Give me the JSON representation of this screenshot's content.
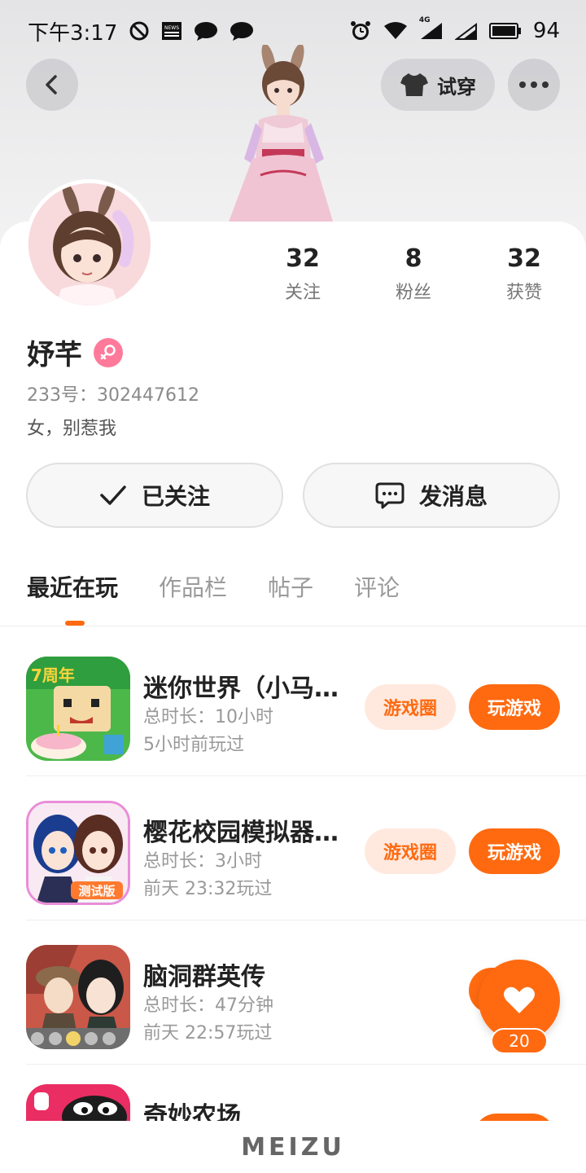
{
  "status_bar": {
    "time": "下午3:17",
    "battery": "94",
    "network": "4G",
    "news_icon_text": "NEWS"
  },
  "header": {
    "tryon_label": "试穿"
  },
  "profile": {
    "stats": [
      {
        "value": "32",
        "label": "关注"
      },
      {
        "value": "8",
        "label": "粉丝"
      },
      {
        "value": "32",
        "label": "获赞"
      }
    ],
    "username": "妤芊",
    "uid": "233号：302447612",
    "bio": "女，别惹我",
    "follow_label": "已关注",
    "message_label": "发消息"
  },
  "tabs": [
    {
      "label": "最近在玩",
      "active": true
    },
    {
      "label": "作品栏",
      "active": false
    },
    {
      "label": "帖子",
      "active": false
    },
    {
      "label": "评论",
      "active": false
    }
  ],
  "games": [
    {
      "title": "迷你世界（小马…",
      "duration": "总时长：10小时",
      "last_played": "5小时前玩过",
      "circle_label": "游戏圈",
      "play_label": "玩游戏"
    },
    {
      "title": "樱花校园模拟器…",
      "duration": "总时长：3小时",
      "last_played": "前天 23:32玩过",
      "circle_label": "游戏圈",
      "play_label": "玩游戏"
    },
    {
      "title": "脑洞群英传",
      "duration": "总时长：47分钟",
      "last_played": "前天 22:57玩过"
    },
    {
      "title": "奇妙农场"
    }
  ],
  "like": {
    "count": "20"
  },
  "game_icon_texts": {
    "game1_badge": "7周年",
    "game2_badge": "测试版"
  },
  "brand": "MEIZU",
  "colors": {
    "accent": "#ff6a10",
    "accent_light": "#ffe9df",
    "gender": "#ff7a9a"
  }
}
